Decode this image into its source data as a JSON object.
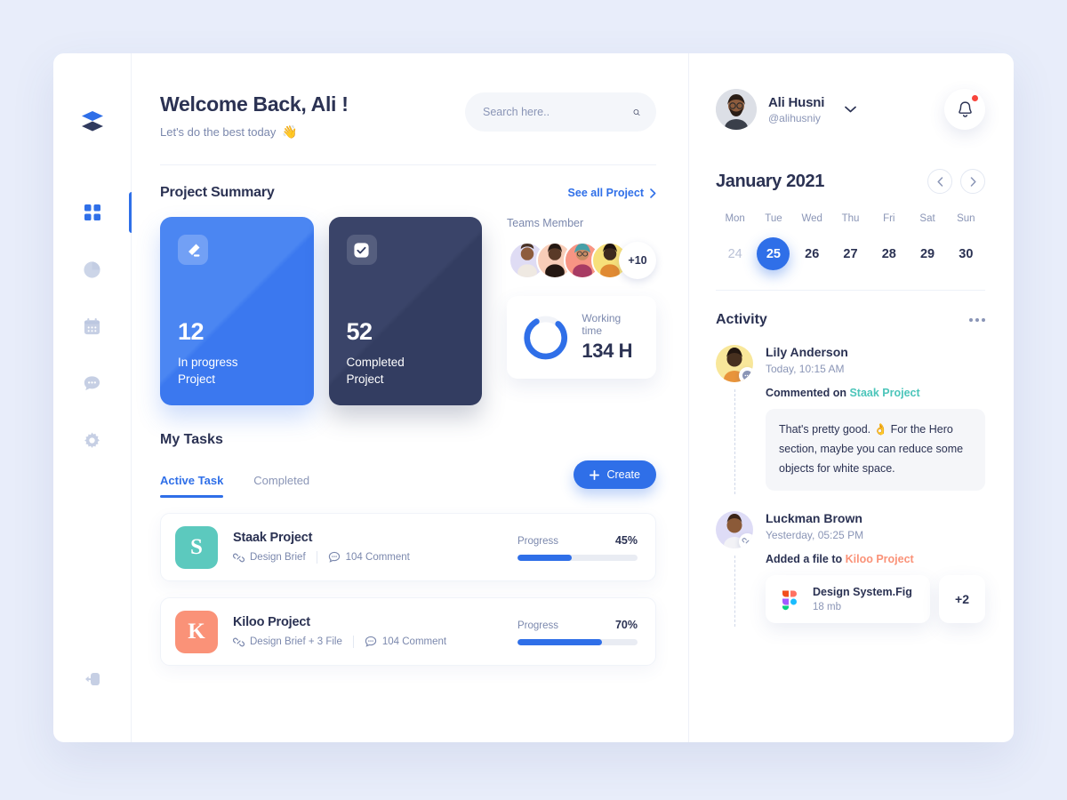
{
  "sidebar": {
    "logo_icon": "layers-logo-icon",
    "items": [
      {
        "icon": "grid-dashboard-icon",
        "name": "dashboard",
        "active": true
      },
      {
        "icon": "pie-chart-icon",
        "name": "analytics",
        "active": false
      },
      {
        "icon": "calendar-icon",
        "name": "calendar",
        "active": false
      },
      {
        "icon": "chat-bubble-icon",
        "name": "messages",
        "active": false
      },
      {
        "icon": "gear-settings-icon",
        "name": "settings",
        "active": false
      }
    ],
    "logout_icon": "logout-icon"
  },
  "header": {
    "title": "Welcome Back, Ali !",
    "subtitle": "Let's do the best today",
    "wave_emoji": "👋"
  },
  "search": {
    "placeholder": "Search here..",
    "value": "",
    "icon": "search-icon"
  },
  "project_summary": {
    "title": "Project Summary",
    "see_all": "See all Project",
    "cards": [
      {
        "value": "12",
        "label": "In progress\nProject",
        "label_line1": "In progress",
        "label_line2": "Project",
        "icon": "pencil-edit-icon",
        "color": "#3b78ef"
      },
      {
        "value": "52",
        "label_line1": "Completed",
        "label_line2": "Project",
        "icon": "checkbox-check-icon",
        "color": "#343e63"
      }
    ]
  },
  "teams": {
    "title": "Teams Member",
    "avatars": [
      {
        "name": "member-1",
        "bg": "#dfdcf4"
      },
      {
        "name": "member-2",
        "bg": "#f8cdb8"
      },
      {
        "name": "member-3",
        "bg": "#f79584"
      },
      {
        "name": "member-4",
        "bg": "#f7e07a"
      }
    ],
    "more_count": "+10"
  },
  "working_time": {
    "label": "Working time",
    "value": "134 H",
    "percent": 80,
    "ring_color": "#2f6fe8",
    "track_color": "#f1f3f8"
  },
  "tasks": {
    "title": "My Tasks",
    "tabs": [
      {
        "label": "Active Task",
        "active": true
      },
      {
        "label": "Completed",
        "active": false
      }
    ],
    "create_label": "Create",
    "create_icon": "plus-icon",
    "items": [
      {
        "badge_letter": "S",
        "badge_color": "#5cc9be",
        "name": "Staak Project",
        "attachment_icon": "link-icon",
        "attachment": "Design Brief",
        "comment_icon": "comment-icon",
        "comments": "104 Comment",
        "progress_label": "Progress",
        "progress_pct": "45%",
        "progress_value": 45
      },
      {
        "badge_letter": "K",
        "badge_color": "#fa9278",
        "name": "Kiloo Project",
        "attachment_icon": "link-icon",
        "attachment": "Design Brief  + 3 File",
        "comment_icon": "comment-icon",
        "comments": "104 Comment",
        "progress_label": "Progress",
        "progress_pct": "70%",
        "progress_value": 70
      }
    ]
  },
  "profile": {
    "name": "Ali Husni",
    "handle": "@alihusniy",
    "avatar_name": "user-avatar",
    "chevron_icon": "chevron-down-icon",
    "bell_icon": "bell-notification-icon",
    "has_notification": true
  },
  "calendar": {
    "title": "January 2021",
    "prev_icon": "chevron-left-icon",
    "next_icon": "chevron-right-icon",
    "dow": [
      "Mon",
      "Tue",
      "Wed",
      "Thu",
      "Fri",
      "Sat",
      "Sun"
    ],
    "days": [
      {
        "n": "24",
        "muted": true,
        "selected": false
      },
      {
        "n": "25",
        "muted": false,
        "selected": true
      },
      {
        "n": "26",
        "muted": false,
        "selected": false
      },
      {
        "n": "27",
        "muted": false,
        "selected": false
      },
      {
        "n": "28",
        "muted": false,
        "selected": false
      },
      {
        "n": "29",
        "muted": false,
        "selected": false
      },
      {
        "n": "30",
        "muted": false,
        "selected": false
      }
    ]
  },
  "activity": {
    "title": "Activity",
    "menu_icon": "more-options-icon",
    "items": [
      {
        "name": "Lily Anderson",
        "time": "Today, 10:15 AM",
        "badge_icon": "comment-icon",
        "avatar_bg": "#f8e79a",
        "action_prefix": "Commented on",
        "action_target": "Staak Project",
        "target_color": "#4cc5ba",
        "comment": "That's pretty good. 👌 For the Hero section, maybe you can reduce some objects for white space."
      },
      {
        "name": "Luckman Brown",
        "time": "Yesterday, 05:25 PM",
        "badge_icon": "link-icon",
        "avatar_bg": "#dedcf6",
        "action_prefix": "Added a file to",
        "action_target": "Kiloo Project",
        "target_color": "#fa9278",
        "file": {
          "icon": "figma-icon",
          "name": "Design System.Fig",
          "size": "18 mb"
        },
        "more_files": "+2"
      }
    ]
  },
  "colors": {
    "page_bg": "#e8edfa",
    "accent": "#2f6fe8",
    "dark": "#343e63",
    "teal": "#5cc9be",
    "salmon": "#fa9278",
    "red_dot": "#f8453c"
  }
}
